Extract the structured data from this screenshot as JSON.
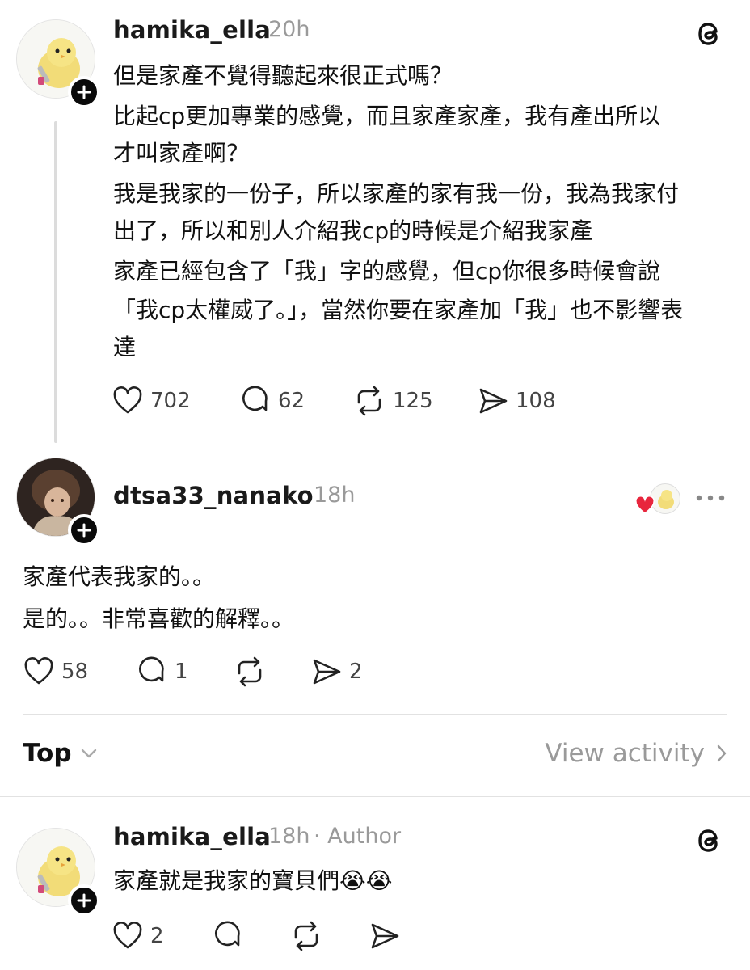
{
  "posts": [
    {
      "username": "hamika_ella",
      "time": "20h",
      "lines": [
        "但是家產不覺得聽起來很正式嗎？",
        "比起cp更加專業的感覺，而且家產家產，我有產出所以",
        "才叫家產啊？",
        "我是我家的一份子，所以家產的家有我一份，我為我家付",
        "出了，所以和別人介紹我cp的時候是介紹我家產",
        "家產已經包含了「我」字的感覺，但cp你很多時候會說",
        "「我cp太權威了。」，當然你要在家產加「我」也不影響表",
        "達"
      ],
      "likes": "702",
      "replies": "62",
      "reposts": "125",
      "shares": "108"
    },
    {
      "username": "dtsa33_nanako",
      "time": "18h",
      "lines": [
        "家產代表我家的。。",
        "是的。。非常喜歡的解釋。。"
      ],
      "likes": "58",
      "replies": "1",
      "reposts": "",
      "shares": "2"
    }
  ],
  "sort": {
    "label": "Top",
    "view_activity": "View activity"
  },
  "reply": {
    "username": "hamika_ella",
    "time": "18h",
    "author_tag": "· Author",
    "text": "家產就是我家的寶貝們",
    "emoji": "😭😭",
    "likes": "2"
  },
  "colors": {
    "heart": "#e8263d",
    "chick": "#f5e27a",
    "text": "#111111",
    "muted": "#9a9a9a"
  },
  "icons": [
    "threads-icon",
    "heart-icon",
    "comment-icon",
    "repost-icon",
    "share-icon",
    "more-icon",
    "plus-icon",
    "chevron-down-icon",
    "chevron-right-icon"
  ]
}
